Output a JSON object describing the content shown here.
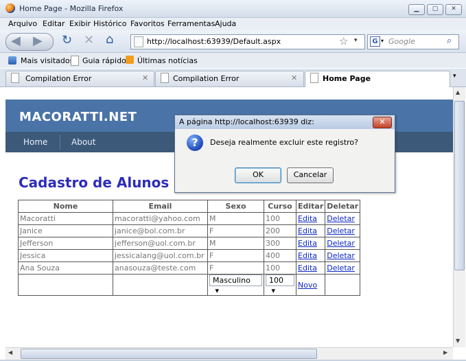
{
  "window": {
    "title": "Home Page - Mozilla Firefox"
  },
  "menu": [
    "Arquivo",
    "Editar",
    "Exibir",
    "Histórico",
    "Favoritos",
    "Ferramentas",
    "Ajuda"
  ],
  "nav": {
    "url": "http://localhost:63939/Default.aspx",
    "search_placeholder": "Google"
  },
  "bookmarks": [
    "Mais visitados",
    "Guia rápido",
    "Últimas notícias"
  ],
  "tabs": [
    {
      "label": "Compilation Error",
      "active": false
    },
    {
      "label": "Compilation Error",
      "active": false
    },
    {
      "label": "Home Page",
      "active": true
    }
  ],
  "site": {
    "logo": "MACORATTI.NET",
    "nav": [
      "Home",
      "About"
    ],
    "heading": "Cadastro de Alunos"
  },
  "grid": {
    "headers": [
      "Nome",
      "Email",
      "Sexo",
      "Curso",
      "Editar",
      "Deletar"
    ],
    "rows": [
      {
        "nome": "Macoratti",
        "email": "macoratti@yahoo.com",
        "sexo": "M",
        "curso": "100",
        "editar": "Edita",
        "deletar": "Deletar"
      },
      {
        "nome": "Janice",
        "email": "janice@bol.com.br",
        "sexo": "F",
        "curso": "200",
        "editar": "Edita",
        "deletar": "Deletar"
      },
      {
        "nome": "Jefferson",
        "email": "jefferson@uol.com.br",
        "sexo": "M",
        "curso": "300",
        "editar": "Edita",
        "deletar": "Deletar"
      },
      {
        "nome": "Jessica",
        "email": "jessicalang@uol.com.br",
        "sexo": "F",
        "curso": "400",
        "editar": "Edita",
        "deletar": "Deletar"
      },
      {
        "nome": "Ana Souza",
        "email": "anasouza@teste.com",
        "sexo": "F",
        "curso": "100",
        "editar": "Edita",
        "deletar": "Deletar"
      }
    ],
    "footer": {
      "sexo_selected": "Masculino",
      "curso_selected": "100",
      "novo": "Novo"
    }
  },
  "dialog": {
    "title": "A página http://localhost:63939 diz:",
    "message": "Deseja realmente excluir este registro?",
    "ok": "OK",
    "cancel": "Cancelar"
  }
}
